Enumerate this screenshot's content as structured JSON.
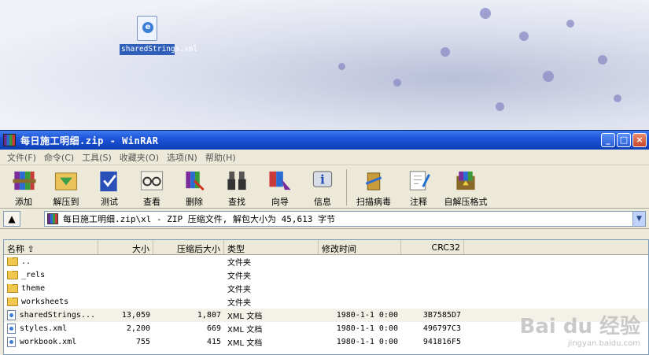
{
  "desktop": {
    "icon_label": "sharedStrings.xml"
  },
  "window": {
    "title": "每日施工明细.zip - WinRAR",
    "controls": {
      "minimize": "_",
      "maximize": "□",
      "close": "×"
    }
  },
  "menu": [
    "文件(F)",
    "命令(C)",
    "工具(S)",
    "收藏夹(O)",
    "选项(N)",
    "帮助(H)"
  ],
  "toolbar": [
    {
      "label": "添加",
      "icon": "add-books-icon"
    },
    {
      "label": "解压到",
      "icon": "extract-folder-icon"
    },
    {
      "label": "测试",
      "icon": "test-check-icon"
    },
    {
      "label": "查看",
      "icon": "view-glasses-icon"
    },
    {
      "label": "删除",
      "icon": "delete-icon"
    },
    {
      "label": "查找",
      "icon": "binoculars-icon"
    },
    {
      "label": "向导",
      "icon": "wizard-icon"
    },
    {
      "label": "信息",
      "icon": "info-icon"
    },
    {
      "label": "扫描病毒",
      "icon": "virus-scan-icon"
    },
    {
      "label": "注释",
      "icon": "comment-pen-icon"
    },
    {
      "label": "自解压格式",
      "icon": "sfx-box-icon"
    }
  ],
  "address": {
    "path": "每日施工明细.zip\\xl - ZIP 压缩文件, 解包大小为 45,613 字节"
  },
  "table": {
    "headers": [
      "名称",
      "大小",
      "压缩后大小",
      "类型",
      "修改时间",
      "CRC32"
    ],
    "rows": [
      {
        "name": "..",
        "size": "",
        "packed": "",
        "type": "文件夹",
        "date": "",
        "crc": "",
        "kind": "folder"
      },
      {
        "name": "_rels",
        "size": "",
        "packed": "",
        "type": "文件夹",
        "date": "",
        "crc": "",
        "kind": "folder"
      },
      {
        "name": "theme",
        "size": "",
        "packed": "",
        "type": "文件夹",
        "date": "",
        "crc": "",
        "kind": "folder"
      },
      {
        "name": "worksheets",
        "size": "",
        "packed": "",
        "type": "文件夹",
        "date": "",
        "crc": "",
        "kind": "folder"
      },
      {
        "name": "sharedStrings...",
        "size": "13,059",
        "packed": "1,807",
        "type": "XML 文档",
        "date": "1980-1-1 0:00",
        "crc": "3B7585D7",
        "kind": "xml"
      },
      {
        "name": "styles.xml",
        "size": "2,200",
        "packed": "669",
        "type": "XML 文档",
        "date": "1980-1-1 0:00",
        "crc": "496797C3",
        "kind": "xml"
      },
      {
        "name": "workbook.xml",
        "size": "755",
        "packed": "415",
        "type": "XML 文档",
        "date": "1980-1-1 0:00",
        "crc": "941816F5",
        "kind": "xml"
      }
    ]
  },
  "watermark": {
    "main": "Bai du 经验",
    "sub": "jingyan.baidu.com"
  }
}
